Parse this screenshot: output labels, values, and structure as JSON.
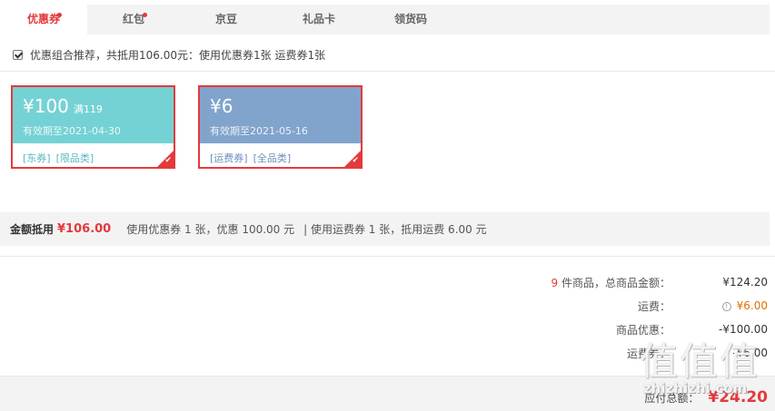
{
  "tabs": [
    {
      "label": "优惠券",
      "active": true,
      "dot": true
    },
    {
      "label": "红包",
      "active": false,
      "dot": true
    },
    {
      "label": "京豆",
      "active": false,
      "dot": false
    },
    {
      "label": "礼品卡",
      "active": false,
      "dot": false
    },
    {
      "label": "领货码",
      "active": false,
      "dot": false
    }
  ],
  "recommend": {
    "checked": true,
    "text": "优惠组合推荐，共抵用106.00元：使用优惠券1张 运费券1张"
  },
  "coupons": [
    {
      "amount": "¥100",
      "condition": "满119",
      "expire": "有效期至2021-04-30",
      "tag1": "[东券]",
      "tag2": "[限品类]",
      "color": "#74d2d4",
      "selected": true
    },
    {
      "amount": "¥6",
      "condition": "",
      "expire": "有效期至2021-05-16",
      "tag1": "[运费券]",
      "tag2": "[全品类]",
      "color": "#81a4cc",
      "selected": true
    }
  ],
  "amount_bar": {
    "label": "金额抵用",
    "value": "¥106.00",
    "detail1": "使用优惠券 1 张，优惠 100.00 元",
    "detail2": "| 使用运费券 1 张，抵用运费 6.00 元"
  },
  "summary": {
    "count": "9",
    "items_label": "件商品，总商品金额：",
    "items_value": "¥124.20",
    "shipping_label": "运费：",
    "shipping_value": "¥6.00",
    "discount_label": "商品优惠：",
    "discount_value": "-¥100.00",
    "shipping2_label": "运费券：",
    "shipping2_value": "-¥6.00",
    "pay_label": "应付总额：",
    "pay_value": "¥24.20"
  },
  "watermark": {
    "glyphs": "值值值",
    "site": "zhizhizhi.com"
  },
  "colors": {
    "accent": "#e4393c",
    "tab_bg": "#f3f3f3",
    "coupon_teal": "#74d2d4",
    "coupon_blue": "#81a4cc"
  }
}
